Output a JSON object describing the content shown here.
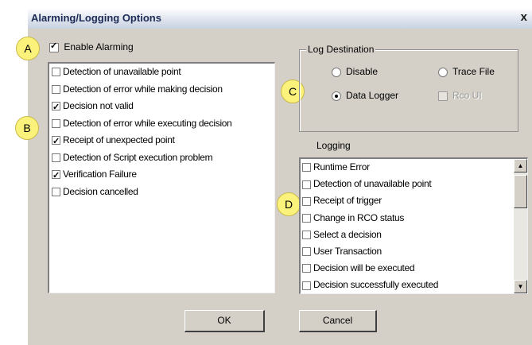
{
  "window": {
    "title": "Alarming/Logging Options",
    "close_glyph": "x"
  },
  "callouts": [
    "A",
    "B",
    "C",
    "D"
  ],
  "alarming": {
    "enable_label": "Enable Alarming",
    "enable_checked": true,
    "items": [
      {
        "label": "Detection of unavailable point",
        "checked": false
      },
      {
        "label": "Detection of error while making decision",
        "checked": false
      },
      {
        "label": "Decision not valid",
        "checked": true
      },
      {
        "label": "Detection of error while executing decision",
        "checked": false
      },
      {
        "label": "Receipt of unexpected point",
        "checked": true
      },
      {
        "label": "Detection of Script execution problem",
        "checked": false
      },
      {
        "label": "Verification Failure",
        "checked": true
      },
      {
        "label": "Decision cancelled",
        "checked": false
      }
    ]
  },
  "log_destination": {
    "group_label": "Log Destination",
    "disable_label": "Disable",
    "trace_file_label": "Trace File",
    "data_logger_label": "Data Logger",
    "rco_ui_label": "Rco UI",
    "selected": "Data Logger"
  },
  "logging": {
    "label": "Logging",
    "items": [
      {
        "label": "Runtime Error",
        "checked": false
      },
      {
        "label": "Detection of unavailable point",
        "checked": false
      },
      {
        "label": "Receipt of trigger",
        "checked": false
      },
      {
        "label": "Change in RCO status",
        "checked": false
      },
      {
        "label": "Select a decision",
        "checked": false
      },
      {
        "label": "User Transaction",
        "checked": false
      },
      {
        "label": "Decision will be executed",
        "checked": false
      },
      {
        "label": "Decision successfully executed",
        "checked": false
      }
    ]
  },
  "buttons": {
    "ok": "OK",
    "cancel": "Cancel"
  }
}
